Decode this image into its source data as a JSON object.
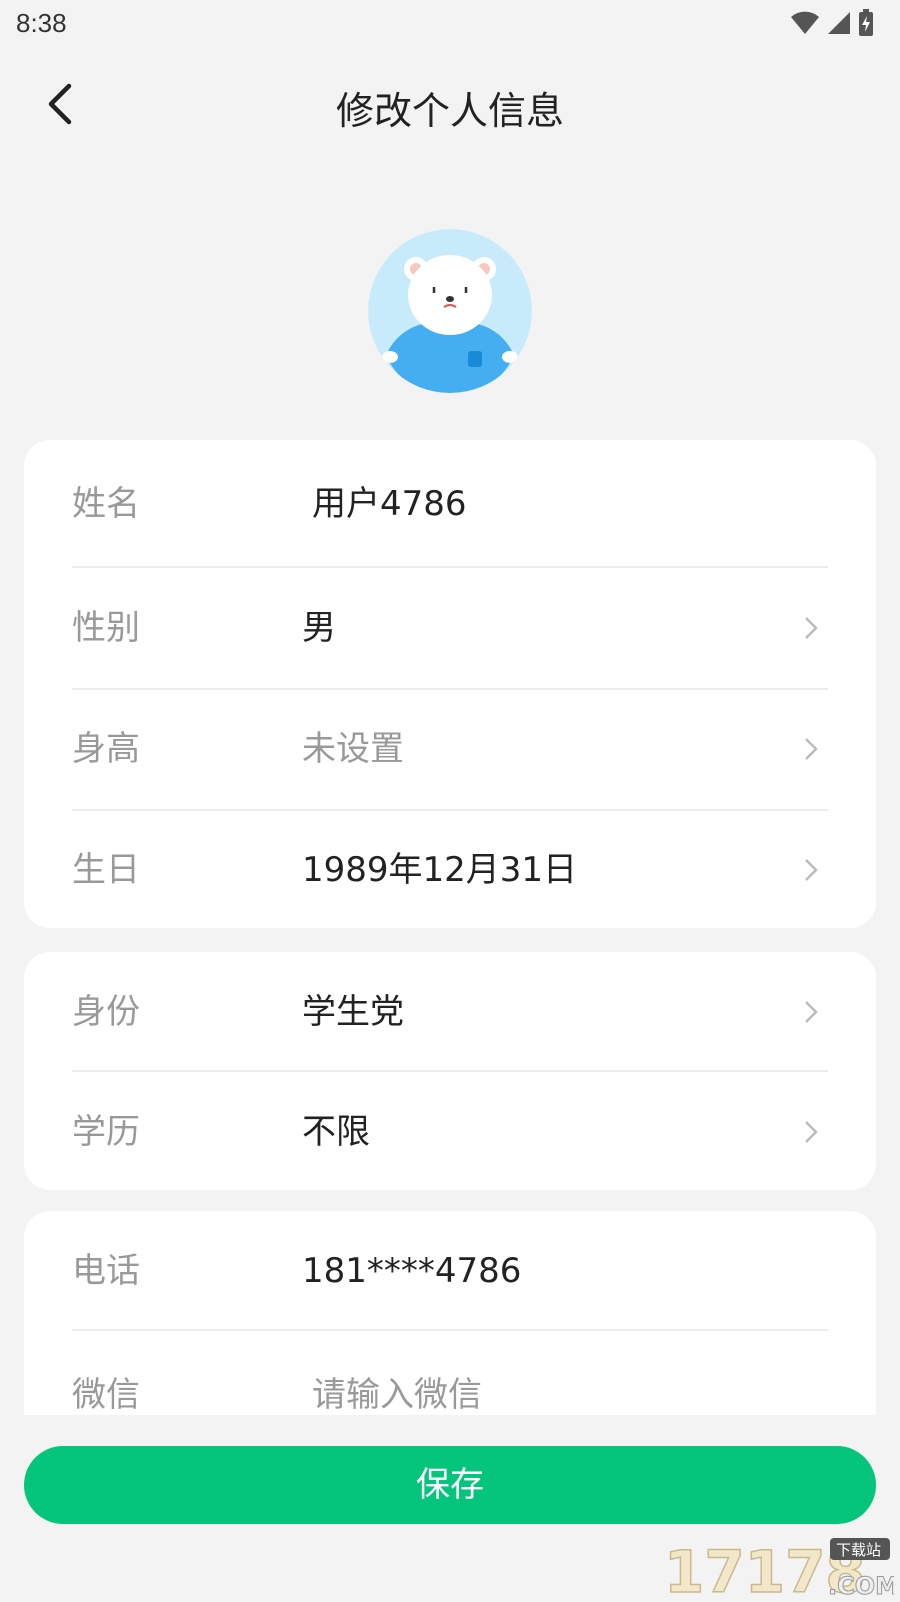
{
  "status_bar": {
    "time": "8:38",
    "icons": [
      "wifi-icon",
      "signal-icon",
      "battery-charging-icon"
    ]
  },
  "header": {
    "back_icon": "chevron-left-icon",
    "title": "修改个人信息"
  },
  "avatar": {
    "icon": "polar-bear-avatar"
  },
  "card_basic": {
    "rows": [
      {
        "label": "姓名",
        "value": "用户4786",
        "editable": true
      },
      {
        "label": "性别",
        "value": "男"
      },
      {
        "label": "身高",
        "value": "未设置",
        "placeholder": true
      },
      {
        "label": "生日",
        "value": "1989年12月31日"
      }
    ]
  },
  "card_identity": {
    "rows": [
      {
        "label": "身份",
        "value": "学生党"
      },
      {
        "label": "学历",
        "value": "不限"
      }
    ]
  },
  "card_contact": {
    "rows": [
      {
        "label": "电话",
        "value": "181****4786"
      },
      {
        "label": "微信",
        "placeholder": "请输入微信"
      }
    ]
  },
  "save_button": {
    "label": "保存"
  },
  "watermark": {
    "text": "17178",
    "sub": "下载站",
    "domain": ".COM"
  },
  "colors": {
    "accent": "#05c47c",
    "background": "#f3f3f3",
    "label": "#999999"
  }
}
